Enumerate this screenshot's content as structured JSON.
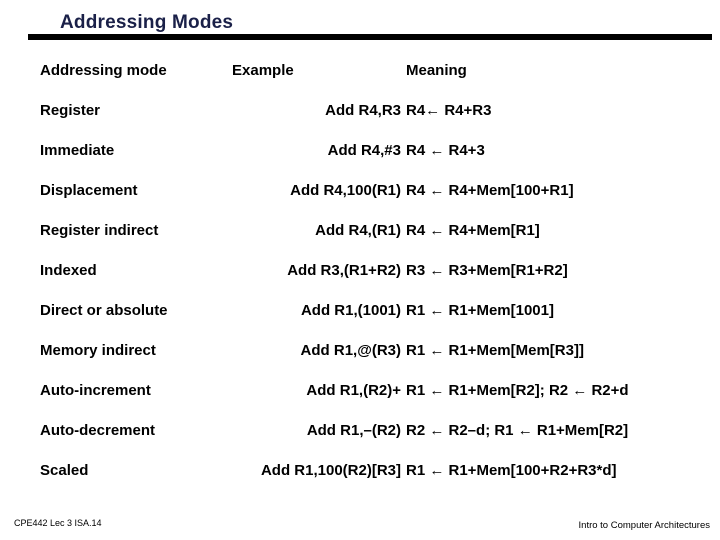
{
  "slide": {
    "title": "Addressing Modes",
    "rule_color": "#000000",
    "title_color": "#1a2048"
  },
  "table": {
    "headers": {
      "mode": "Addressing mode",
      "example": "Example",
      "meaning": "Meaning"
    },
    "rows": [
      {
        "mode": "Register",
        "example": "Add R4,R3",
        "meaning": "R4← R4+R3"
      },
      {
        "mode": "Immediate",
        "example": "Add R4,#3",
        "meaning": "R4 ← R4+3"
      },
      {
        "mode": "Displacement",
        "example": "Add R4,100(R1)",
        "meaning": "R4 ← R4+Mem[100+R1]"
      },
      {
        "mode": "Register indirect",
        "example": "Add R4,(R1)",
        "meaning": "R4 ← R4+Mem[R1]"
      },
      {
        "mode": "Indexed",
        "example": "Add R3,(R1+R2)",
        "meaning": "R3 ← R3+Mem[R1+R2]"
      },
      {
        "mode": "Direct or absolute",
        "example": "Add R1,(1001)",
        "meaning": "R1 ← R1+Mem[1001]"
      },
      {
        "mode": "Memory indirect",
        "example": "Add R1,@(R3)",
        "meaning": "R1 ← R1+Mem[Mem[R3]]"
      },
      {
        "mode": "Auto-increment",
        "example": "Add R1,(R2)+",
        "meaning": "R1 ← R1+Mem[R2]; R2 ← R2+d"
      },
      {
        "mode": "Auto-decrement",
        "example": "Add R1,–(R2)",
        "meaning": "R2 ← R2–d; R1 ← R1+Mem[R2]"
      },
      {
        "mode": "Scaled",
        "example": "Add R1,100(R2)[R3]",
        "meaning": "R1 ← R1+Mem[100+R2+R3*d]"
      }
    ]
  },
  "footer": {
    "left": "CPE442  Lec 3 ISA.14",
    "right": "Intro to Computer Architectures"
  }
}
